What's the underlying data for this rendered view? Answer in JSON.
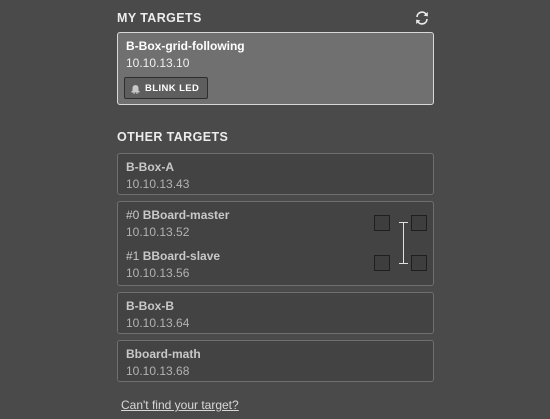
{
  "my_targets": {
    "heading": "MY TARGETS",
    "refresh_icon": "refresh-icon",
    "selected": {
      "name": "B-Box-grid-following",
      "ip": "10.10.13.10",
      "blink_label": "BLINK LED",
      "blink_icon": "led-icon"
    }
  },
  "other_targets": {
    "heading": "OTHER TARGETS",
    "box_a": {
      "name": "B-Box-A",
      "ip": "10.10.13.43"
    },
    "group": {
      "master": {
        "prefix": "#0",
        "name": "BBoard-master",
        "ip": "10.10.13.52"
      },
      "slave": {
        "prefix": "#1",
        "name": "BBoard-slave",
        "ip": "10.10.13.56"
      }
    },
    "box_b": {
      "name": "B-Box-B",
      "ip": "10.10.13.64"
    },
    "math": {
      "name": "Bboard-math",
      "ip": "10.10.13.68"
    }
  },
  "help_link": "Can't find your target?",
  "colors": {
    "background": "#4a4a4a",
    "selected_card": "#707070",
    "card": "#434343"
  }
}
